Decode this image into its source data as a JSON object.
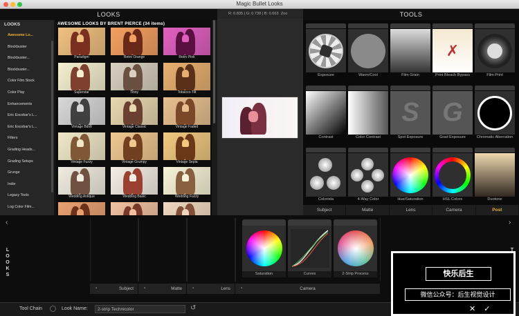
{
  "window": {
    "title": "Magic Bullet Looks"
  },
  "looks_panel": {
    "header": "LOOKS"
  },
  "categories": {
    "title": "LOOKS",
    "items": [
      "Awesome Lo...",
      "Blockbuster",
      "Blockbuster...",
      "Blockbuster...",
      "Color Film Stock",
      "Color Play",
      "Enhancements",
      "Eric Escobar's L...",
      "Eric Escobar's L...",
      "Filters",
      "Grading Heads...",
      "Grading Setups",
      "Grunge",
      "Indie",
      "Legacy Tools",
      "Log Color Film..."
    ],
    "active_index": 0
  },
  "grid": {
    "title": "AWESOME LOOKS BY BRENT PIERCE (34 items)",
    "thumbs": [
      {
        "label": "Paradigm",
        "bg": "#f0c080",
        "fg": "#7a3020"
      },
      {
        "label": "Retro Orange",
        "bg": "#f4a060",
        "fg": "#6a2818"
      },
      {
        "label": "Retro Pink",
        "bg": "#e060c0",
        "fg": "#5a1040"
      },
      {
        "label": "Superstar",
        "bg": "#f4f0d0",
        "fg": "#804030"
      },
      {
        "label": "Tinny",
        "bg": "#d8d0c0",
        "fg": "#6a5040"
      },
      {
        "label": "Tobacco-Tilt",
        "bg": "#e8b070",
        "fg": "#5a3018"
      },
      {
        "label": "Vintage B&W",
        "bg": "#d8d8d8",
        "fg": "#404040"
      },
      {
        "label": "Vintage Classic",
        "bg": "#e8d8b0",
        "fg": "#6a4030"
      },
      {
        "label": "Vintage Faded",
        "bg": "#e8c090",
        "fg": "#7a4828"
      },
      {
        "label": "Vintage Fuzzy",
        "bg": "#f0e8c8",
        "fg": "#805838"
      },
      {
        "label": "Vintage Grumpy",
        "bg": "#f0c890",
        "fg": "#704020"
      },
      {
        "label": "Vintage Sepia",
        "bg": "#f0c880",
        "fg": "#6a3818"
      },
      {
        "label": "Wedding Antique",
        "bg": "#f0ece0",
        "fg": "#705040"
      },
      {
        "label": "Wedding Basic",
        "bg": "#f4eee4",
        "fg": "#9a4030"
      },
      {
        "label": "Wedding Fuzzy",
        "bg": "#f8f4d8",
        "fg": "#886040"
      },
      {
        "label": "",
        "bg": "#e8a070",
        "fg": "#6a3018"
      },
      {
        "label": "",
        "bg": "#f0c0a0",
        "fg": "#7a3828"
      },
      {
        "label": "",
        "bg": "#f0d8c0",
        "fg": "#805038"
      }
    ]
  },
  "viewer": {
    "r": "R: 0.835",
    "g": "G: 0.738",
    "b": "B: 0.663",
    "zoom": "Zoo"
  },
  "tools_panel": {
    "header": "TOOLS"
  },
  "tools": [
    {
      "label": "Exposure",
      "icon": "aperture-icon"
    },
    {
      "label": "Warm/Cool",
      "icon": "gray-circle-icon"
    },
    {
      "label": "Film Grain",
      "icon": "grain-gradient-icon"
    },
    {
      "label": "Print Bleach Bypass",
      "icon": "bleach-bypass-icon"
    },
    {
      "label": "Film Print",
      "icon": "film-reel-icon"
    },
    {
      "label": "Contrast",
      "icon": "contrast-gradient-icon"
    },
    {
      "label": "Color Contrast",
      "icon": "color-contrast-icon"
    },
    {
      "label": "Spot Exposure",
      "icon": "spot-exposure-icon"
    },
    {
      "label": "Grad Exposure",
      "icon": "grad-exposure-icon"
    },
    {
      "label": "Chromatic Aberration",
      "icon": "ring-icon"
    },
    {
      "label": "Colorista",
      "icon": "three-wheels-icon"
    },
    {
      "label": "4-Way Color",
      "icon": "four-wheels-icon"
    },
    {
      "label": "Hue/Saturation",
      "icon": "color-wheel-icon"
    },
    {
      "label": "HSL Colors",
      "icon": "hue-ring-icon"
    },
    {
      "label": "Duotone",
      "icon": "duotone-gradient-icon"
    }
  ],
  "tool_tabs": {
    "items": [
      "Subject",
      "Matte",
      "Lens",
      "Camera",
      "Post"
    ],
    "active_index": 4
  },
  "chain": {
    "side_label_left": "LOOKS",
    "side_label_right": "TOOLS",
    "tools": [
      {
        "label": "Saturation"
      },
      {
        "label": "Curves"
      },
      {
        "label": "2-Strip Process"
      }
    ],
    "stages": [
      "Subject",
      "Matte",
      "Lens",
      "Camera"
    ]
  },
  "bottom": {
    "tool_chain_label": "Tool Chain",
    "look_name_label": "Look Name:",
    "look_name_value": "2-strip Technicolor"
  },
  "overlay": {
    "line1": "快乐后生",
    "line2": "微信公众号：后生视觉设计"
  }
}
